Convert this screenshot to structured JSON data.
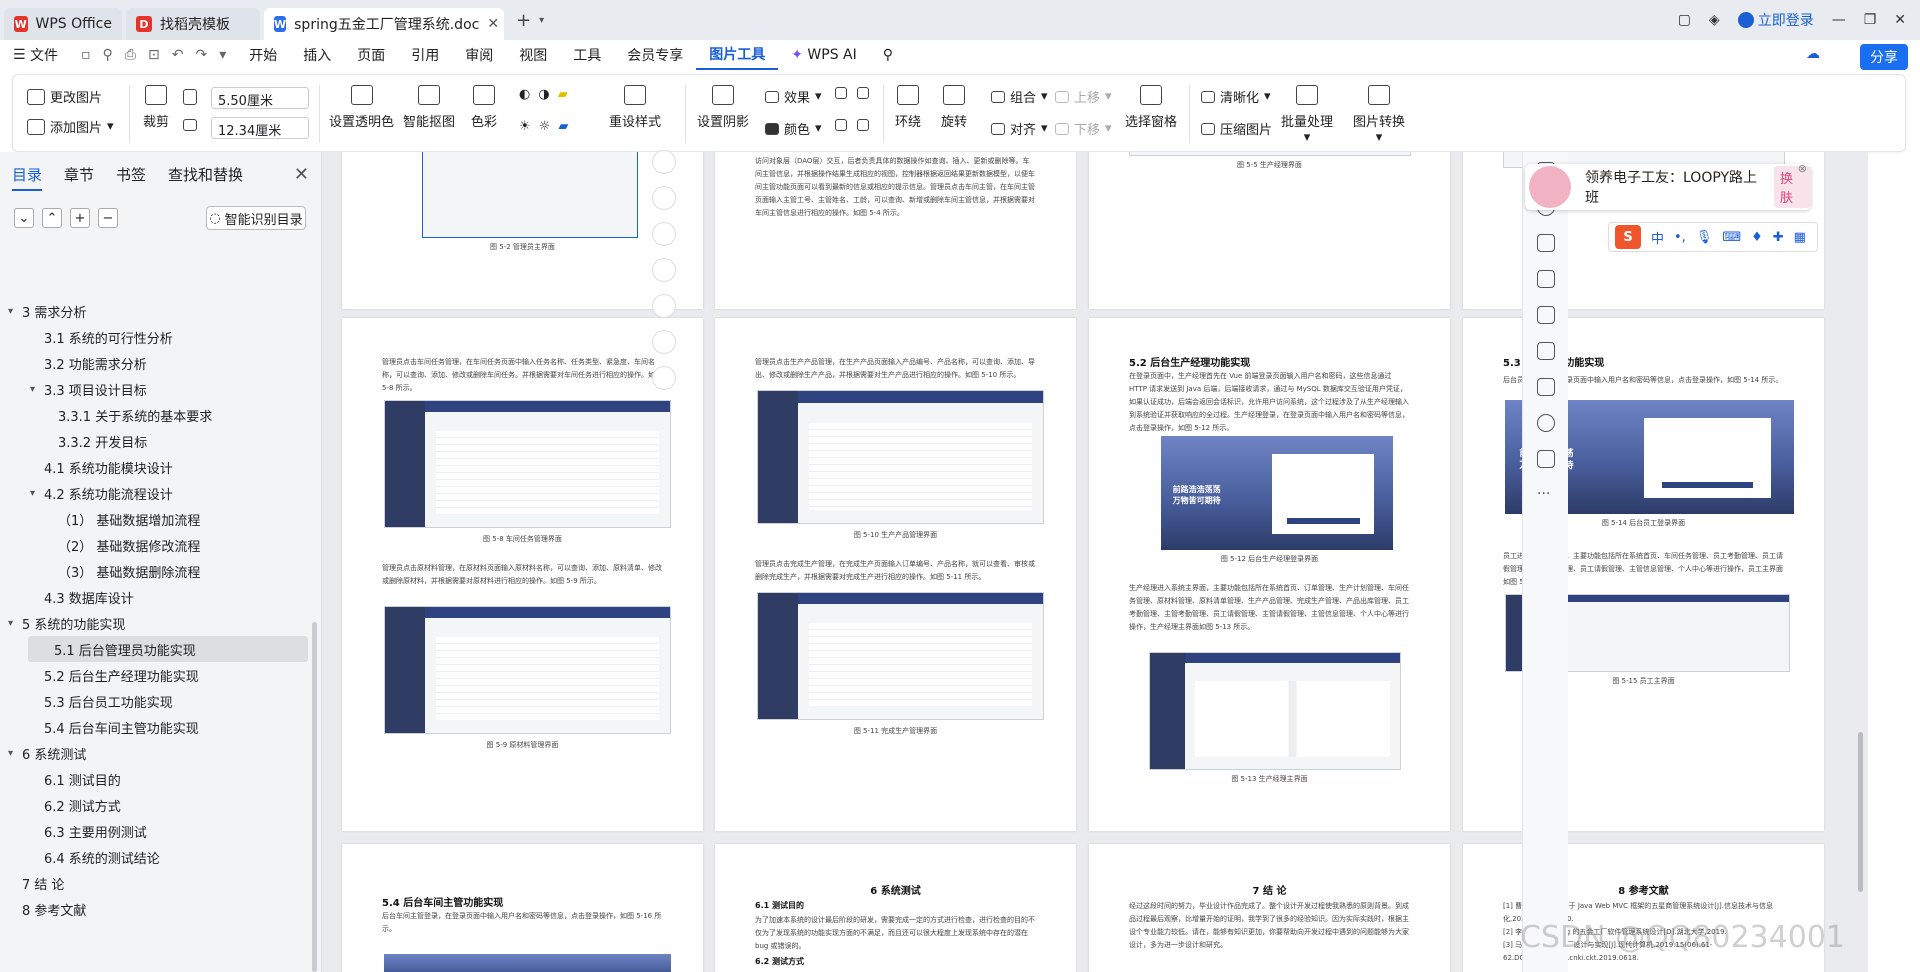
{
  "titlebar": {
    "tabs": [
      {
        "label": "WPS Office",
        "logo": "W"
      },
      {
        "label": "找稻壳模板",
        "logo": "D"
      },
      {
        "label": "spring五金工厂管理系统.doc",
        "logo": "W"
      }
    ],
    "add_tab": "+",
    "login": "立即登录"
  },
  "menubar": {
    "file": "文件",
    "items": [
      "开始",
      "插入",
      "页面",
      "引用",
      "审阅",
      "视图",
      "工具",
      "会员专享",
      "图片工具"
    ],
    "active": "图片工具",
    "wps_ai": "WPS AI",
    "share": "分享"
  },
  "ribbon": {
    "change_image": "更改图片",
    "add_image": "添加图片",
    "crop": "裁剪",
    "width_value": "5.50厘米",
    "height_value": "12.34厘米",
    "set_transparent": "设置透明色",
    "smart_cutout": "智能抠图",
    "color": "色彩",
    "reset_style": "重设样式",
    "shadow": "设置阴影",
    "effect": "效果",
    "fill": "颜色",
    "wrap": "环绕",
    "rotate": "旋转",
    "group": "组合",
    "align": "对齐",
    "move_up": "上移",
    "move_down": "下移",
    "select_pane": "选择窗格",
    "sharpen": "清晰化",
    "compress": "压缩图片",
    "batch": "批量处理",
    "convert": "图片转换"
  },
  "sidebar": {
    "tabs": [
      "目录",
      "章节",
      "书签",
      "查找和替换"
    ],
    "active_tab": "目录",
    "smart_toc": "智能识别目录",
    "toc": [
      {
        "label": "3  需求分析",
        "level": 1,
        "arrow": "▾"
      },
      {
        "label": "3.1  系统的可行性分析",
        "level": 2
      },
      {
        "label": "3.2  功能需求分析",
        "level": 2
      },
      {
        "label": "3.3    项目设计目标",
        "level": 2,
        "arrow": "▾"
      },
      {
        "label": "3.3.1  关于系统的基本要求",
        "level": 3
      },
      {
        "label": "3.3.2 开发目标",
        "level": 3
      },
      {
        "label": "4.1   系统功能模块设计",
        "level": 2
      },
      {
        "label": "4.2   系统功能流程设计",
        "level": 2,
        "arrow": "▾"
      },
      {
        "label": "（1） 基础数据增加流程",
        "level": 3
      },
      {
        "label": "（2） 基础数据修改流程",
        "level": 3
      },
      {
        "label": "（3） 基础数据删除流程",
        "level": 3
      },
      {
        "label": "4.3   数据库设计",
        "level": 2
      },
      {
        "label": "5 系统的功能实现",
        "level": 1,
        "arrow": "▾"
      },
      {
        "label": "5.1 后台管理员功能实现",
        "level": 2,
        "selected": true
      },
      {
        "label": "5.2 后台生产经理功能实现",
        "level": 2
      },
      {
        "label": "5.3 后台员工功能实现",
        "level": 2
      },
      {
        "label": "5.4 后台车间主管功能实现",
        "level": 2
      },
      {
        "label": "6   系统测试",
        "level": 1,
        "arrow": "▾"
      },
      {
        "label": "6.1    测试目的",
        "level": 2
      },
      {
        "label": "6.2    测试方式",
        "level": 2
      },
      {
        "label": "6.3    主要用例测试",
        "level": 2
      },
      {
        "label": "6.4  系统的测试结论",
        "level": 2
      },
      {
        "label": "7  结 论",
        "level": 1
      },
      {
        "label": "8 参考文献",
        "level": 1
      }
    ]
  },
  "pages": {
    "p1_caption": "图 5-2 管理员主界面",
    "p2_text": "例如记录输入数据的有效性和与数据库的交互。服务层处理实际业务逻辑后，进一步与数据访问对象层（DAO层）交互，后者负责具体的数据操作如查询、插入、更新或删除等。车间主管信息，并根据操作结果生成相应的视图，控制器根据返回结果更新数据模型，以便车间主管功能页面可以看到最新的信息或相应的提示信息。管理员点击车间主管，在车间主管页面输入主管工号、主管姓名、工龄，可以查询、新增或删除车间主管信息，并根据需要对车间主管信息进行相应的操作。如图 5-4 所示。",
    "p3_caption": "图 5-5 生产经理界面",
    "p5_text1": "管理员点击车间任务管理，在车间任务页面中输入任务名称、任务类型、紧急度、车间名称，可以查询、添加、修改或删除车间任务。并根据需要对车间任务进行相应的操作。如图 5-8 所示。",
    "p5_caption1": "图 5-8 车间任务管理界面",
    "p5_text2": "管理员点击原材料管理，在原材料页面输入原材料名称，可以查询、添加、原料清单、修改或删除原材料，并根据需要对原材料进行相应的操作。如图 5-9 所示。",
    "p5_caption2": "图 5-9 原材料管理界面",
    "p6_text1": "管理员点击生产产品管理，在生产产品页面输入产品编号、产品名称，可以查询、添加、导出、修改或删除生产产品，并根据需要对生产产品进行相应的操作。如图 5-10 所示。",
    "p6_caption1": "图 5-10 生产产品管理界面",
    "p6_text2": "管理员点击完成生产管理，在完成生产页面输入订单编号、产品名称，就可以查看、审核或删除完成生产，并根据需要对完成生产进行相应的操作。如图 5-11 所示。",
    "p6_caption2": "图 5-11 完成生产管理界面",
    "p7_heading": "5.2 后台生产经理功能实现",
    "p7_text": "在登录页面中，生产经理首先在 Vue 前端登录页面输入用户名和密码，这些信息通过 HTTP 请求发送到 Java 后端，后端接收请求，通过与 MySQL 数据库交互验证用户凭证，如果认证成功，后端会返回会话标识，允许用户访问系统，这个过程涉及了从生产经理输入到系统验证并获取响应的全过程。生产经理登录，在登录页面中输入用户名和密码等信息，点击登录操作，如图 5-12 所示。",
    "p7_login_title": "前路浩浩荡荡\n万物皆可期待",
    "p7_caption1": "图 5-12 后台生产经理登录界面",
    "p7_text2": "生产经理进入系统主界面，主要功能包括所在系统首页、订单管理、生产计划管理、车间任务管理、原材料管理、原料清单管理、生产产品管理、完成生产管理、产品出库管理、员工考勤管理、主管考勤管理、员工请假管理、主管请假管理、主管信息管理、个人中心等进行操作，生产经理主界面如图 5-13 所示。",
    "p7_caption2": "图 5-13 生产经理主界面",
    "p8_heading": "5.3 后台员工功能实现",
    "p8_text": "后台员工登录，在登录页面中输入用户名和密码等信息，点击登录操作，如图 5-14 所示。",
    "p8_caption1": "图 5-14 后台员工登录界面",
    "p8_text2": "员工进入系统主界面，主要功能包括所在系统首页、车间任务管理、员工考勤管理、员工请假管理、主管请假管理、员工请假管理、主管信息管理、个人中心等进行操作，员工主界面如图 5-15 所示。",
    "p8_caption2": "图 5-15 员工主界面",
    "p9_heading": "5.4 后台车间主管功能实现",
    "p9_text": "后台车间主管登录，在登录页面中输入用户名和密码等信息，点击登录操作，如图 5-16 所示。",
    "p10_heading": "6 系统测试",
    "p10_sub": "6.1  测试目的",
    "p10_text": "为了加速本系统的设计最后阶段的研发，需要完成一定的方式进行检查，进行检查的目的不仅为了发现系统的功能实现方面的不满足，而且还可以很大程度上发现系统中存在的潜在 bug 或错误的。",
    "p10_sub2": "6.2  测试方式",
    "p11_heading": "7 结 论",
    "p11_text": "经过这段时间的努力，毕业设计作品完成了。整个设计开发过程使我熟悉的原则背景。到成品过程最后观察，比增量开始的证明，我学到了很多的经验知识。因为实际实践时，根据主设个专业能力较低。请在，能够有知识更加，你要帮助向开发过程中遇到的问题能够为大家设计，多为进一步设计和研究。",
    "p12_heading": "8 参考文献",
    "p12_text": "[1] 曹雅晶,李佳宁.基于 Java Web MVC 框架的五星商管理系统设计[J].信息技术与信息化,2020.4(04)37-40.\n[2] 李雪 基于 Spring 的五金工厂软件管理系统设计[D].湖北大学,2019.\n[3] 马鸿 基于五金工厂设计与实现[J].现代计算机,2019.15(06):61-62.DOI:10.14004/j.cnki.ckt.2019.0618."
  },
  "overlay": {
    "ad_text": "领养电子工友：LOOPY路上班",
    "ad_switch": "换肤",
    "ime_logo": "S",
    "ime_mode": "中",
    "watermark": "CSDN @QQ80234001"
  }
}
